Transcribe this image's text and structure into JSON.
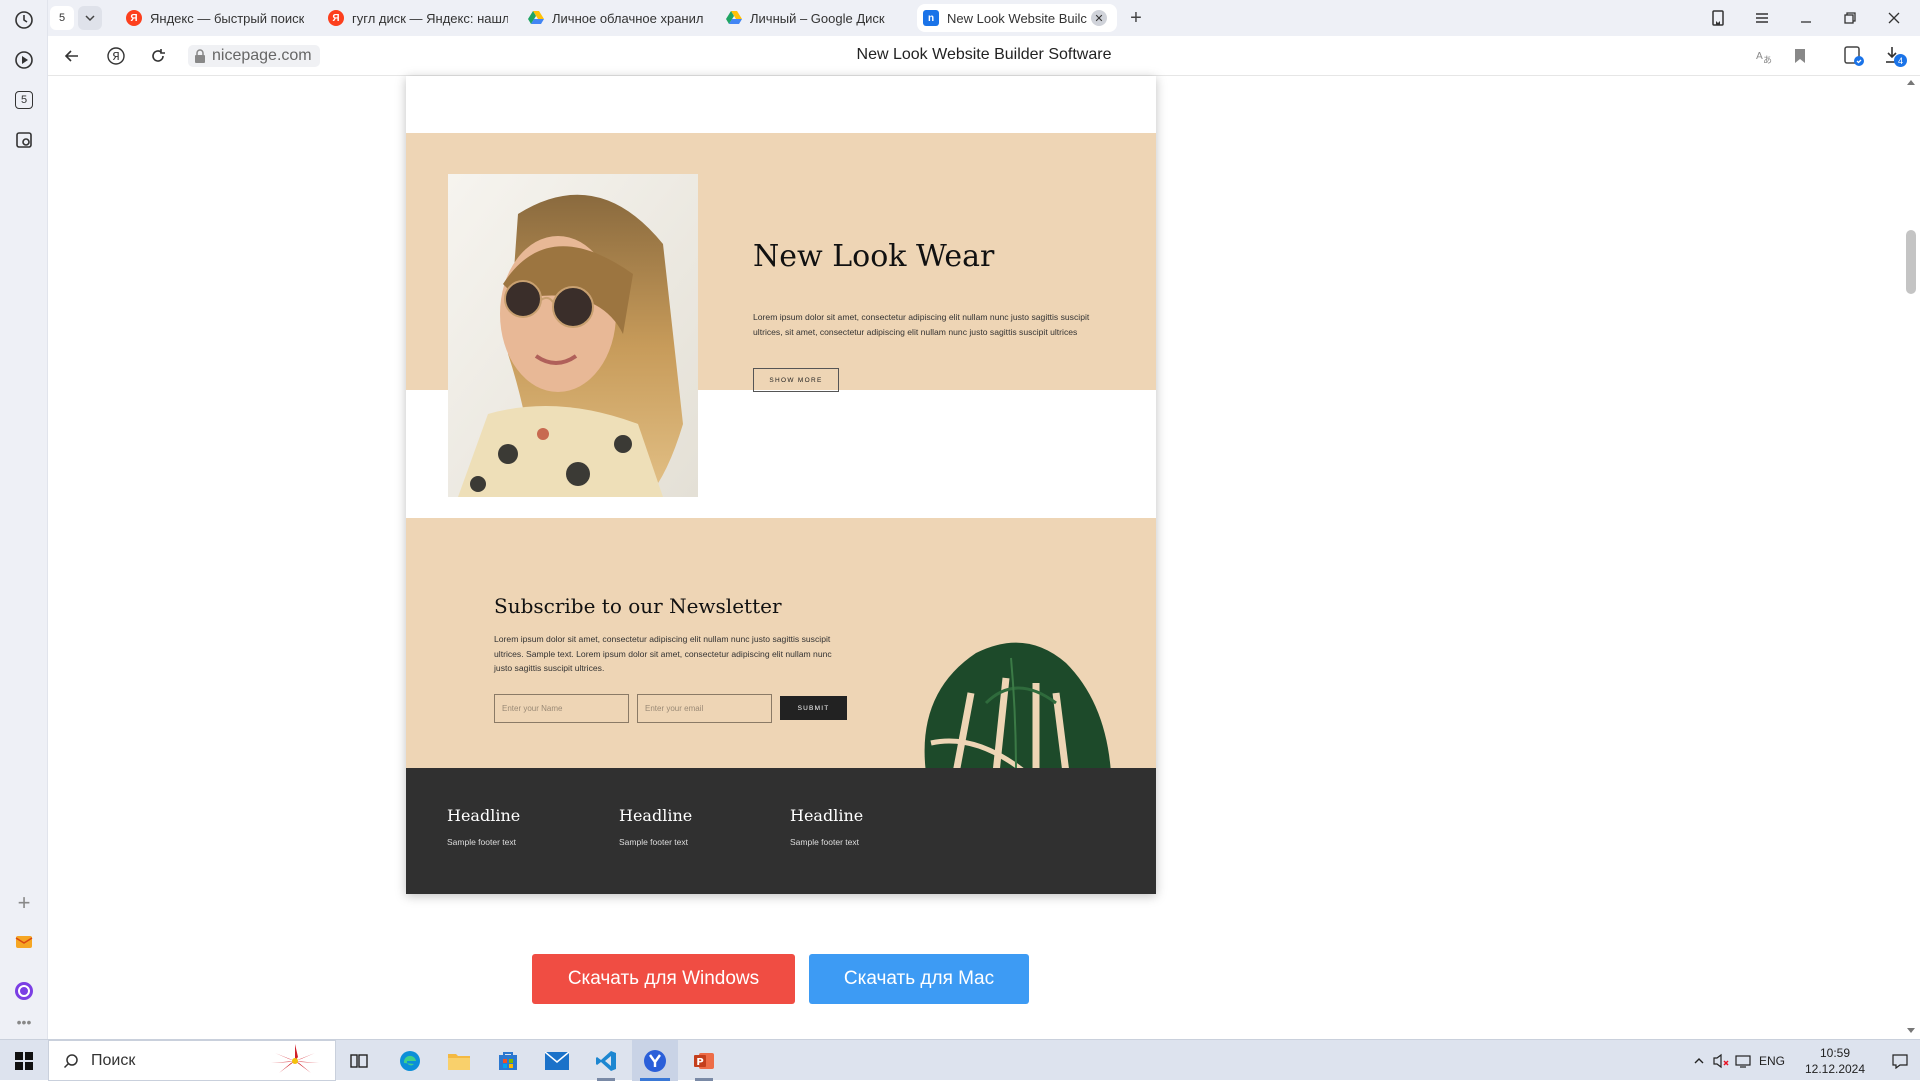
{
  "browser": {
    "tab_count_badge": "5",
    "tabs": [
      {
        "label": "Яндекс — быстрый поиск",
        "favicon": "yandex-icon",
        "color": "#f33"
      },
      {
        "label": "гугл диск — Яндекс: нашл",
        "favicon": "yandex-icon",
        "color": "#f33"
      },
      {
        "label": "Личное облачное хранил",
        "favicon": "google-drive-icon",
        "color": "#1fa463"
      },
      {
        "label": "Личный – Google Диск",
        "favicon": "google-drive-icon",
        "color": "#1fa463"
      },
      {
        "label": "New Look Website Builc",
        "favicon": "nicepage-icon",
        "color": "#1a73e8",
        "active": true
      }
    ],
    "url": "nicepage.com",
    "page_title": "New Look Website Builder Software",
    "downloads_badge": "4",
    "sidebar_badge": "5"
  },
  "preview": {
    "hero": {
      "title": "New Look Wear",
      "text": "Lorem ipsum dolor sit amet, consectetur adipiscing elit nullam nunc justo sagittis suscipit ultrices, sit amet, consectetur adipiscing elit nullam nunc justo sagittis suscipit ultrices",
      "button": "SHOW MORE"
    },
    "newsletter": {
      "title": "Subscribe to our Newsletter",
      "text": "Lorem ipsum dolor sit amet, consectetur adipiscing elit nullam nunc justo sagittis suscipit ultrices. Sample text. Lorem ipsum dolor sit amet, consectetur adipiscing elit nullam nunc justo sagittis suscipit ultrices.",
      "name_placeholder": "Enter your Name",
      "email_placeholder": "Enter your email",
      "submit": "SUBMIT"
    },
    "footer": [
      {
        "headline": "Headline",
        "text": "Sample footer text"
      },
      {
        "headline": "Headline",
        "text": "Sample footer text"
      },
      {
        "headline": "Headline",
        "text": "Sample footer text"
      }
    ],
    "colors": {
      "beige": "#eed5b5",
      "footer": "#303030"
    }
  },
  "downloads": {
    "windows": "Скачать для Windows",
    "mac": "Скачать для Mac"
  },
  "taskbar": {
    "search_label": "Поиск",
    "lang": "ENG",
    "time": "10:59",
    "date": "12.12.2024"
  }
}
